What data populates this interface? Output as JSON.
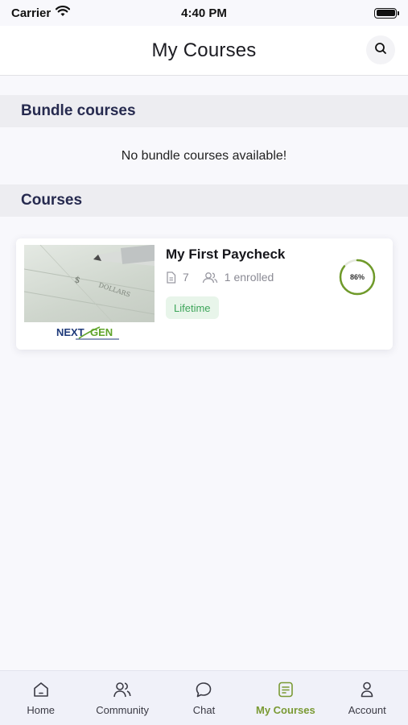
{
  "status_bar": {
    "carrier": "Carrier",
    "time": "4:40 PM"
  },
  "header": {
    "title": "My Courses",
    "search_icon": "search-icon"
  },
  "bundle_section": {
    "title": "Bundle courses",
    "empty_message": "No bundle courses available!"
  },
  "courses_section": {
    "title": "Courses",
    "items": [
      {
        "title": "My First Paycheck",
        "lessons": "7",
        "enrolled": "1 enrolled",
        "badge": "Lifetime",
        "progress_label": "86%",
        "progress": 0.86,
        "thumbnail_logo_text": "NEXT GEN"
      }
    ]
  },
  "tabs": [
    {
      "label": "Home",
      "icon": "home-icon"
    },
    {
      "label": "Community",
      "icon": "community-icon"
    },
    {
      "label": "Chat",
      "icon": "chat-icon"
    },
    {
      "label": "My Courses",
      "icon": "courses-icon",
      "active": true
    },
    {
      "label": "Account",
      "icon": "account-icon"
    }
  ],
  "colors": {
    "accent": "#7a9a34",
    "section_title": "#262a4f",
    "badge_bg": "#e8f5ea",
    "badge_text": "#3ea55a",
    "progress_ring": "#6f9a2a"
  }
}
